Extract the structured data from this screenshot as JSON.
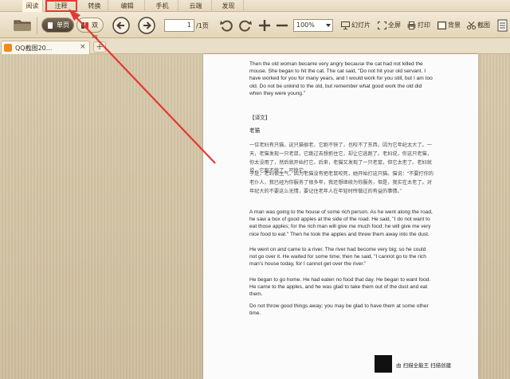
{
  "menu": {
    "tabs": [
      "阅读",
      "注释",
      "转换",
      "编辑",
      "手机",
      "云端",
      "发现"
    ]
  },
  "toolbar": {
    "single_page": "单页",
    "double_page": "双页",
    "page_current": "1",
    "page_total": "/1页",
    "zoom": "100%",
    "slideshow": "幻灯片",
    "fullscreen": "全屏",
    "print": "打印",
    "background": "背景",
    "screenshot": "截图"
  },
  "tabs": {
    "doc_label": "QQ截图20...",
    "close": "×",
    "new": "+"
  },
  "document": {
    "p1": "Then the old woman became very angry because the cat had not killed the mouse. She began to hit the cat. The cat said, \"Do not hit your old servant. I have worked for you for many years, and I would work for you still, but I am too old. Do not be unkind to the old, but remember what good work the old did when they were young.\"",
    "heading": "【译文】",
    "cn_title": "老猫",
    "cn1": "一位老妇有只猫，这只猫很老，它跑不快了，也咬不了东西，因为它年纪太大了。一天，老猫发现一只老鼠，它跳过去想抓住它，却让它逃跑了。老妇说，你这只老猫，你太没用了，然后就开始打它，后来，老猫又发现了一只老鼠，但它太老了。老妇就说，它跑不快了，可怜它。",
    "cn2": "于是，老妇很生气，因为老猫没有把老鼠咬死，她开始打这只猫。猫说：“不要打你的老仆人，我已经为你服务了很多年，我还想继续为你服务，但是，我实在太老了。对年纪大的不要这么无情，要记住老年人在年轻时所做过的有益的事情。”",
    "p2": "A man was going to the house of some rich person. As he went along the road, he saw a box of good apples at the side of the road. He said, \"I do not want to eat those apples; for the rich man will give me much food; he will give me very nice food to eat.\" Then he took the apples and threw them away into the dust.",
    "p3": "He went on and came to a river. The river had become very big; so he could not go over it. He waited for some time; then he said, \"I cannot go to the rich man's house today, for I cannot get over the river.\"",
    "p4": "He began to go home. He had eaten no food that day. He began to want food. He came to the apples, and he was glad to take them out of the dust and eat them.",
    "p5": "Do not throw good things away; you may be glad to have them at some other time.",
    "footer": "由 扫描全能王 扫描创建"
  },
  "colors": {
    "annotation_red": "#e23a33",
    "qq_orange": "#f08a1c"
  }
}
